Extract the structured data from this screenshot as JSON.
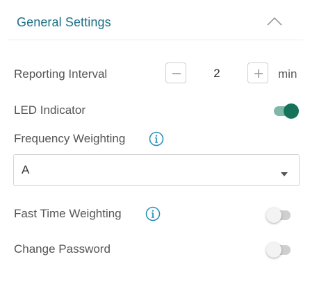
{
  "section": {
    "title": "General Settings",
    "collapse_icon": "chevron-up-icon"
  },
  "reporting_interval": {
    "label": "Reporting Interval",
    "decrement_icon": "minus-icon",
    "value": "2",
    "increment_icon": "plus-icon",
    "unit": "min"
  },
  "led_indicator": {
    "label": "LED Indicator",
    "enabled": true
  },
  "frequency_weighting": {
    "label": "Frequency Weighting",
    "info_icon": "info-icon",
    "selected": "A",
    "dropdown_icon": "caret-down-icon"
  },
  "fast_time_weighting": {
    "label": "Fast Time Weighting",
    "info_icon": "info-icon",
    "enabled": false
  },
  "change_password": {
    "label": "Change Password",
    "enabled": false
  },
  "colors": {
    "accent": "#1a6f86",
    "toggle_on_knob": "#16735a",
    "toggle_on_track": "#7fb8a7",
    "toggle_off_track": "#cfcfcf",
    "info_icon": "#2a93b8",
    "text": "#555555"
  }
}
